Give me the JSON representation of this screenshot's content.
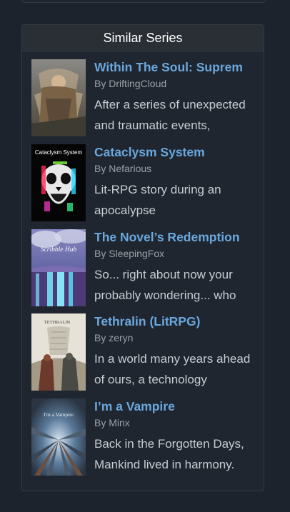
{
  "panel": {
    "title": "Similar Series"
  },
  "series": [
    {
      "title": "Within The Soul: Suprem",
      "author": "By DriftingCloud",
      "description": "After a series of unexpected and traumatic events,",
      "cover_icon": "warrior-cover-art"
    },
    {
      "title": "Cataclysm System",
      "author": "By Nefarious",
      "description": "Lit-RPG story during an apocalypse",
      "cover_icon": "skull-cover-art",
      "cover_text": "Cataclysm System"
    },
    {
      "title": "The Novel’s Redemption",
      "author": "By SleepingFox",
      "description": "So... right about now your probably wondering... who",
      "cover_icon": "waterfall-cover-art",
      "cover_text": "Scribble Hub"
    },
    {
      "title": "Tethralin (LitRPG)",
      "author": "By zeryn",
      "description": "In a world many years ahead of ours, a technology",
      "cover_icon": "tower-cover-art",
      "cover_text": "TETHRALIN"
    },
    {
      "title": "I’m a Vampire",
      "author": "By Minx",
      "description": "Back in the Forgotten Days, Mankind lived in harmony.",
      "cover_icon": "city-cover-art",
      "cover_text": "I'm a Vampire"
    }
  ]
}
